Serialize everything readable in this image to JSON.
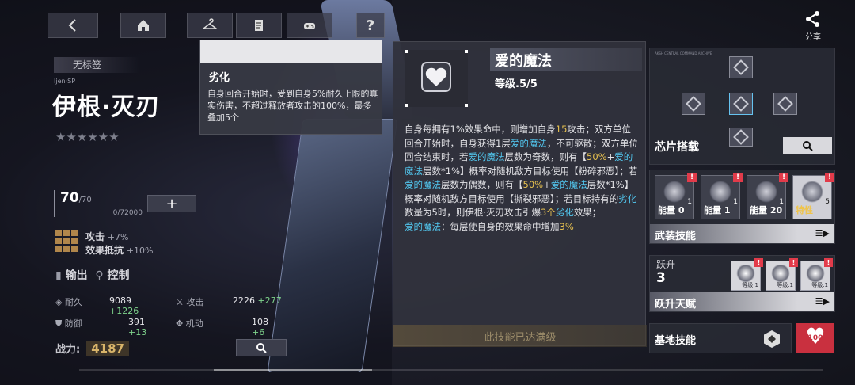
{
  "toolbar": {
    "back_icon": "chevron-left-icon",
    "home_icon": "home-icon",
    "wardrobe_icon": "hanger-icon",
    "archive_icon": "document-icon",
    "game_icon": "gamepad-icon",
    "help_label": "?"
  },
  "share": {
    "label": "分享",
    "icon": "share-icon"
  },
  "character": {
    "tag": "无标签",
    "sub_name": "Ijen·SP",
    "name": "伊根·灭刃",
    "stars": "★★★★★★",
    "level_current": "70",
    "level_max": "/70",
    "exp": "0/72000",
    "plus_label": "+",
    "attr_primary_label": "攻击",
    "attr_primary_value": "+7%",
    "attr_secondary_label": "效果抵抗",
    "attr_secondary_value": "+10%",
    "role_output": "输出",
    "role_control": "控制",
    "stats": {
      "hp_label": "耐久",
      "hp_value": "9089",
      "hp_bonus": "+1226",
      "atk_label": "攻击",
      "atk_value": "2226",
      "atk_bonus": "+277",
      "def_label": "防御",
      "def_value": "391",
      "def_bonus": "+13",
      "spd_label": "机动",
      "spd_value": "108",
      "spd_bonus": "+6"
    },
    "power_label": "战力:",
    "power_value": "4187"
  },
  "tooltip": {
    "title": "劣化",
    "body": "自身回合开始时，受到自身5%耐久上限的真实伤害，不超过释放者攻击的100%，最多叠加5个"
  },
  "skill_detail": {
    "name": "爱的魔法",
    "level": "等级.5/5",
    "desc": {
      "p1": "自身每拥有1%效果命中，则增加自身",
      "n15": "15",
      "p2": "攻击；双方单位回合开始时，自身获得1层",
      "k1": "爱的魔法",
      "p3": "，不可驱散；双方单位回合结束时，若",
      "k2": "爱的魔法",
      "p4": "层数为奇数，则有【",
      "y1": "50%",
      "p5": "+",
      "k3": "爱的魔法",
      "p6": "层数*1%】概率对随机敌方目标使用【粉碎邪恶】；若",
      "k4": "爱的魔法",
      "p7": "层数为偶数，则有【",
      "y2": "50%",
      "p8": "+",
      "k5": "爱的魔法",
      "p9": "层数*1%】概率对随机敌方目标使用【撕裂邪恶】；若目标持有的",
      "k6": "劣化",
      "p10": "数量为5时，则伊根·灭刃攻击引爆",
      "y3": "3个",
      "k7": "劣化",
      "p11": "效果；",
      "k8": "爱的魔法",
      "p12": "：每层使自身的效果命中增加",
      "y4": "3%"
    },
    "max_label": "此技能已达满级"
  },
  "chips": {
    "label": "芯片搭载",
    "fine_print": "AKSH CENTRAL COMMAND ARCHIVE",
    "search_icon": "search-icon"
  },
  "armed_skills": {
    "label": "武装技能",
    "items": [
      {
        "cap": "能量 0",
        "lv": "1",
        "badge": "!"
      },
      {
        "cap": "能量 1",
        "lv": "1",
        "badge": "!"
      },
      {
        "cap": "能量 20",
        "lv": "1",
        "badge": "!"
      },
      {
        "cap": "特性",
        "lv": "5",
        "badge": "!"
      }
    ]
  },
  "ascension": {
    "label": "跃升",
    "value": "3",
    "footer": "跃升天赋",
    "items": [
      {
        "lv": "等级.1",
        "badge": "!"
      },
      {
        "lv": "等级.1",
        "badge": "!"
      },
      {
        "lv": "等级.1",
        "badge": "!"
      }
    ]
  },
  "base_skill": {
    "label": "基地技能"
  },
  "affection": {
    "value": "100"
  },
  "colors": {
    "accent_yellow": "#e6c04f",
    "accent_blue": "#52c8f0",
    "badge_red": "#e23b4a"
  }
}
